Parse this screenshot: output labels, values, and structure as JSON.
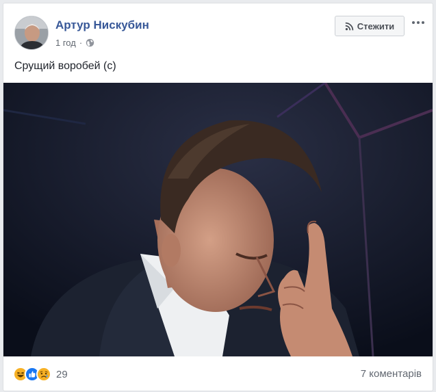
{
  "post": {
    "author": "Артур Нискубин",
    "time": "1 год",
    "separator": "·",
    "privacy_icon": "globe-icon",
    "text": "Срущий воробей (с)",
    "photo_icon": "man-facepalm-photo"
  },
  "header": {
    "follow_label": "Стежити",
    "follow_icon": "rss-icon",
    "more_icon": "more-options-icon"
  },
  "footer": {
    "reactions": [
      "haha",
      "like",
      "sad"
    ],
    "reaction_count": "29",
    "comments_label": "7 коментарів"
  },
  "colors": {
    "author_link": "#385898",
    "like_blue": "#1877f2",
    "emoji_yellow": "#f7b125"
  }
}
